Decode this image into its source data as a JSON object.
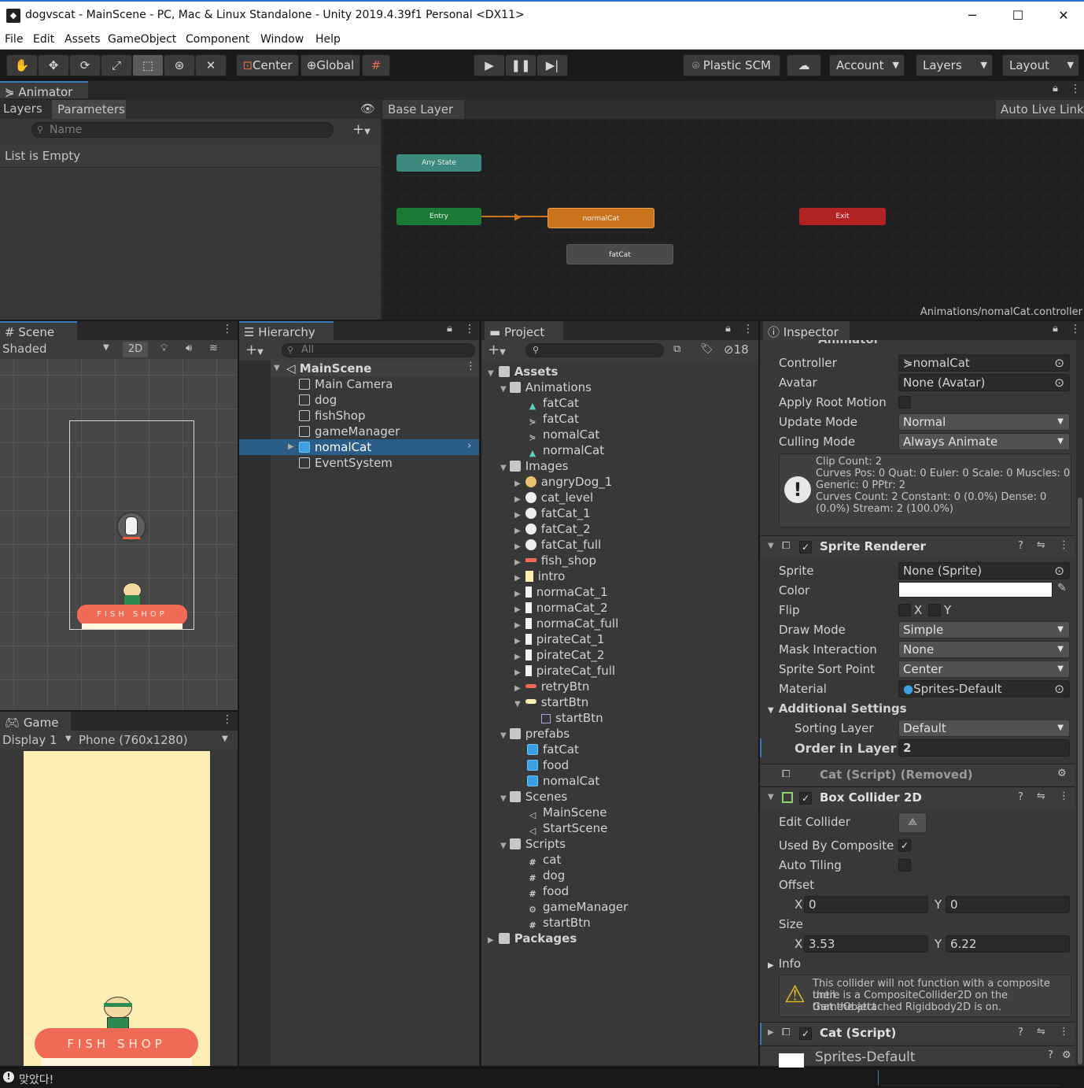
{
  "window": {
    "title": "dogvscat - MainScene - PC, Mac & Linux Standalone - Unity 2019.4.39f1 Personal <DX11>",
    "minimize": "─",
    "maximize": "☐",
    "close": "✕"
  },
  "menu": [
    "File",
    "Edit",
    "Assets",
    "GameObject",
    "Component",
    "Window",
    "Help"
  ],
  "toolbar": {
    "pivot": "Center",
    "space": "Global",
    "plastic": "Plastic SCM",
    "account": "Account",
    "layers": "Layers",
    "layout": "Layout"
  },
  "animator": {
    "tab": "Animator",
    "subtabs": [
      "Layers",
      "Parameters"
    ],
    "search_placeholder": "Name",
    "empty": "List is Empty",
    "breadcrumb": "Base Layer",
    "auto_live_link": "Auto Live Link",
    "states": {
      "any": "Any State",
      "entry": "Entry",
      "normal": "normalCat",
      "exit": "Exit",
      "fat": "fatCat"
    },
    "controller_path": "Animations/nomalCat.controller"
  },
  "scene": {
    "tab": "Scene",
    "shading": "Shaded",
    "mode2d": "2D",
    "sign": "FISH SHOP"
  },
  "game": {
    "tab": "Game",
    "display": "Display 1",
    "resolution": "Phone (760x1280)",
    "sign": "FISH SHOP"
  },
  "hierarchy": {
    "tab": "Hierarchy",
    "search_placeholder": "All",
    "scene": "MainScene",
    "items": [
      "Main Camera",
      "dog",
      "fishShop",
      "gameManager",
      "nomalCat",
      "EventSystem"
    ]
  },
  "project": {
    "tab": "Project",
    "hidden_count": "18",
    "root": "Assets",
    "animations_folder": "Animations",
    "animations": [
      "fatCat",
      "fatCat",
      "nomalCat",
      "normalCat"
    ],
    "images_folder": "Images",
    "images": [
      "angryDog_1",
      "cat_level",
      "fatCat_1",
      "fatCat_2",
      "fatCat_full",
      "fish_shop",
      "intro",
      "normaCat_1",
      "normaCat_2",
      "normaCat_full",
      "pirateCat_1",
      "pirateCat_2",
      "pirateCat_full",
      "retryBtn",
      "startBtn"
    ],
    "startbtn_child": "startBtn",
    "prefabs_folder": "prefabs",
    "prefabs": [
      "fatCat",
      "food",
      "nomalCat"
    ],
    "scenes_folder": "Scenes",
    "scenes": [
      "MainScene",
      "StartScene"
    ],
    "scripts_folder": "Scripts",
    "scripts": [
      "cat",
      "dog",
      "food",
      "gameManager",
      "startBtn"
    ],
    "packages": "Packages"
  },
  "inspector": {
    "tab": "Inspector",
    "animator_title": "Animator",
    "animator": {
      "controller_label": "Controller",
      "controller": "nomalCat",
      "avatar_label": "Avatar",
      "avatar": "None (Avatar)",
      "root_motion_label": "Apply Root Motion",
      "update_label": "Update Mode",
      "update": "Normal",
      "culling_label": "Culling Mode",
      "culling": "Always Animate",
      "info_lines": [
        "Clip Count: 2",
        "Curves Pos: 0 Quat: 0 Euler: 0 Scale: 0 Muscles: 0",
        "Generic: 0 PPtr: 2",
        "Curves Count: 2 Constant: 0 (0.0%) Dense: 0",
        "(0.0%) Stream: 2 (100.0%)"
      ]
    },
    "sprite_renderer": {
      "title": "Sprite Renderer",
      "sprite_label": "Sprite",
      "sprite": "None (Sprite)",
      "color_label": "Color",
      "color_value": "#ffffff",
      "flip_label": "Flip",
      "flip_x": "X",
      "flip_y": "Y",
      "draw_label": "Draw Mode",
      "draw": "Simple",
      "mask_label": "Mask Interaction",
      "mask": "None",
      "sort_point_label": "Sprite Sort Point",
      "sort_point": "Center",
      "material_label": "Material",
      "material": "Sprites-Default",
      "additional": "Additional Settings",
      "sorting_layer_label": "Sorting Layer",
      "sorting_layer": "Default",
      "order_label": "Order in Layer",
      "order": "2"
    },
    "cat_removed": "Cat (Script) (Removed)",
    "box_collider": {
      "title": "Box Collider 2D",
      "edit_label": "Edit Collider",
      "composite_label": "Used By Composite",
      "tiling_label": "Auto Tiling",
      "offset_label": "Offset",
      "offset_x": "0",
      "offset_y": "0",
      "size_label": "Size",
      "size_x": "3.53",
      "size_y": "6.22",
      "x": "X",
      "y": "Y",
      "info_label": "Info",
      "warning": [
        "This collider will not function with a composite until",
        "there is a CompositeCollider2D on the GameObject",
        "that the attached Rigidbody2D is on."
      ]
    },
    "cat_script": "Cat (Script)",
    "material_preview": "Sprites-Default"
  },
  "status": {
    "message": "맞았다!"
  },
  "colors": {
    "selection": "#2c5d87",
    "tab_accent": "#3a79bb",
    "state_any": "#3d8a7e",
    "state_entry": "#1d7a35",
    "state_default": "#c9731b",
    "state_exit": "#b32222",
    "state_normal": "#4a4a4a"
  }
}
